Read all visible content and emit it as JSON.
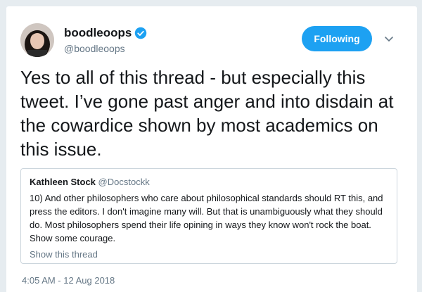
{
  "user": {
    "name": "boodleoops",
    "handle": "@boodleoops",
    "verified": true
  },
  "follow_button": {
    "label": "Following"
  },
  "tweet": {
    "text": "Yes to all of this thread - but especially this tweet. I’ve gone past anger and into disdain at the cowardice shown by most academics on this issue.",
    "timestamp": "4:05 AM - 12 Aug 2018"
  },
  "quoted_tweet": {
    "name": "Kathleen Stock",
    "handle": "@Docstockk",
    "text": "10) And other philosophers who care about philosophical standards should RT this, and press the editors. I don't imagine many will. But that is unambiguously what they should do. Most philosophers spend their life opining in ways they know won't rock the boat. Show some courage.",
    "link_label": "Show this thread"
  },
  "colors": {
    "accent": "#1da1f2",
    "text_primary": "#14171a",
    "text_secondary": "#657786",
    "border": "#ccd6dd"
  },
  "icons": [
    "verified-badge-icon",
    "chevron-down-icon",
    "avatar-image"
  ]
}
